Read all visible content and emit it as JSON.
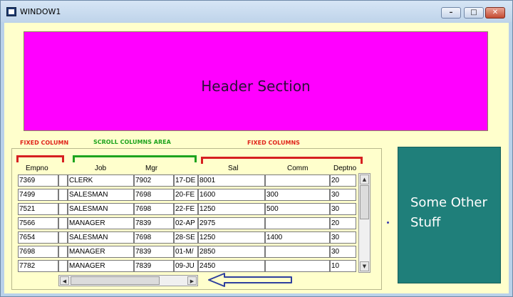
{
  "window": {
    "title": "WINDOW1",
    "min_glyph": "–",
    "max_glyph": "□",
    "close_glyph": "✕"
  },
  "header": {
    "text": "Header Section"
  },
  "labels": {
    "fixed_column": "FIXED COLUMN",
    "scroll_columns": "SCROLL COLUMNS AREA",
    "fixed_columns": "FIXED COLUMNS"
  },
  "columns": [
    "Empno",
    "Job",
    "Mgr",
    "Sal",
    "Comm",
    "Deptno"
  ],
  "rows": [
    {
      "empno": "7369",
      "job": "CLERK",
      "mgr": "7902",
      "hire": "17-DE",
      "sal": "8001",
      "comm": "",
      "deptno": "20"
    },
    {
      "empno": "7499",
      "job": "SALESMAN",
      "mgr": "7698",
      "hire": "20-FE",
      "sal": "1600",
      "comm": "300",
      "deptno": "30"
    },
    {
      "empno": "7521",
      "job": "SALESMAN",
      "mgr": "7698",
      "hire": "22-FE",
      "sal": "1250",
      "comm": "500",
      "deptno": "30"
    },
    {
      "empno": "7566",
      "job": "MANAGER",
      "mgr": "7839",
      "hire": "02-AP",
      "sal": "2975",
      "comm": "",
      "deptno": "20"
    },
    {
      "empno": "7654",
      "job": "SALESMAN",
      "mgr": "7698",
      "hire": "28-SE",
      "sal": "1250",
      "comm": "1400",
      "deptno": "30"
    },
    {
      "empno": "7698",
      "job": "MANAGER",
      "mgr": "7839",
      "hire": "01-M/",
      "sal": "2850",
      "comm": "",
      "deptno": "30"
    },
    {
      "empno": "7782",
      "job": "MANAGER",
      "mgr": "7839",
      "hire": "09-JU",
      "sal": "2450",
      "comm": "",
      "deptno": "10"
    }
  ],
  "scroll": {
    "up": "▲",
    "down": "▼",
    "left": "◀",
    "right": "▶"
  },
  "side_panel": {
    "text": "Some Other Stuff"
  },
  "colors": {
    "header": "#ff00ff",
    "side_panel": "#1f7f7a",
    "client": "#ffffcc",
    "arrow": "#2e3f9e"
  }
}
